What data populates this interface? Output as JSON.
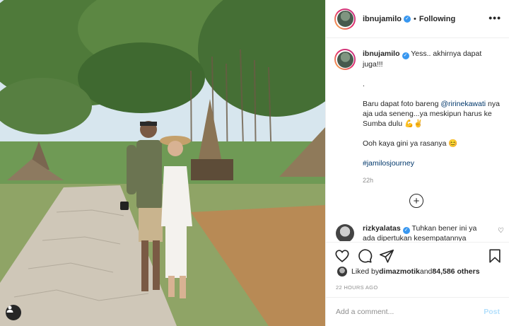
{
  "post": {
    "username": "ibnujamilo",
    "follow_status": "Following",
    "dot": "•",
    "more": "•••",
    "verified_mark": "✓"
  },
  "caption": {
    "username": "ibnujamilo",
    "line1": "Yess.. akhirnya dapat juga!!!",
    "dot_line": ".",
    "p2_before": "Baru dapat foto bareng ",
    "p2_mention": "@ririnekawati",
    "p2_after": " nya aja uda seneng...ya meskipun harus ke Sumba dulu 💪✌",
    "p3": "Ooh kaya gini ya rasanya 😊",
    "hashtag": "#jamilosjourney",
    "time": "22h"
  },
  "load_more_symbol": "+",
  "comment2": {
    "username": "rizkyalatas",
    "text": "Tuhkan bener ini ya ada dipertukan kesempatannya",
    "heart": "♡"
  },
  "likes": {
    "prefix": "Liked by ",
    "user": "dimazmotik",
    "middle": " and ",
    "count": "84,586 others"
  },
  "posted_time": "22 HOURS AGO",
  "add_comment": {
    "placeholder": "Add a comment...",
    "post_label": "Post"
  },
  "icons": {
    "like": "heart-icon",
    "comment": "comment-icon",
    "share": "share-icon",
    "save": "bookmark-icon",
    "tag": "user-tag-icon",
    "more": "more-icon"
  },
  "colors": {
    "link": "#00376b",
    "verified": "#3897f0",
    "post_disabled": "#b2dffc",
    "muted": "#8e8e8e"
  }
}
